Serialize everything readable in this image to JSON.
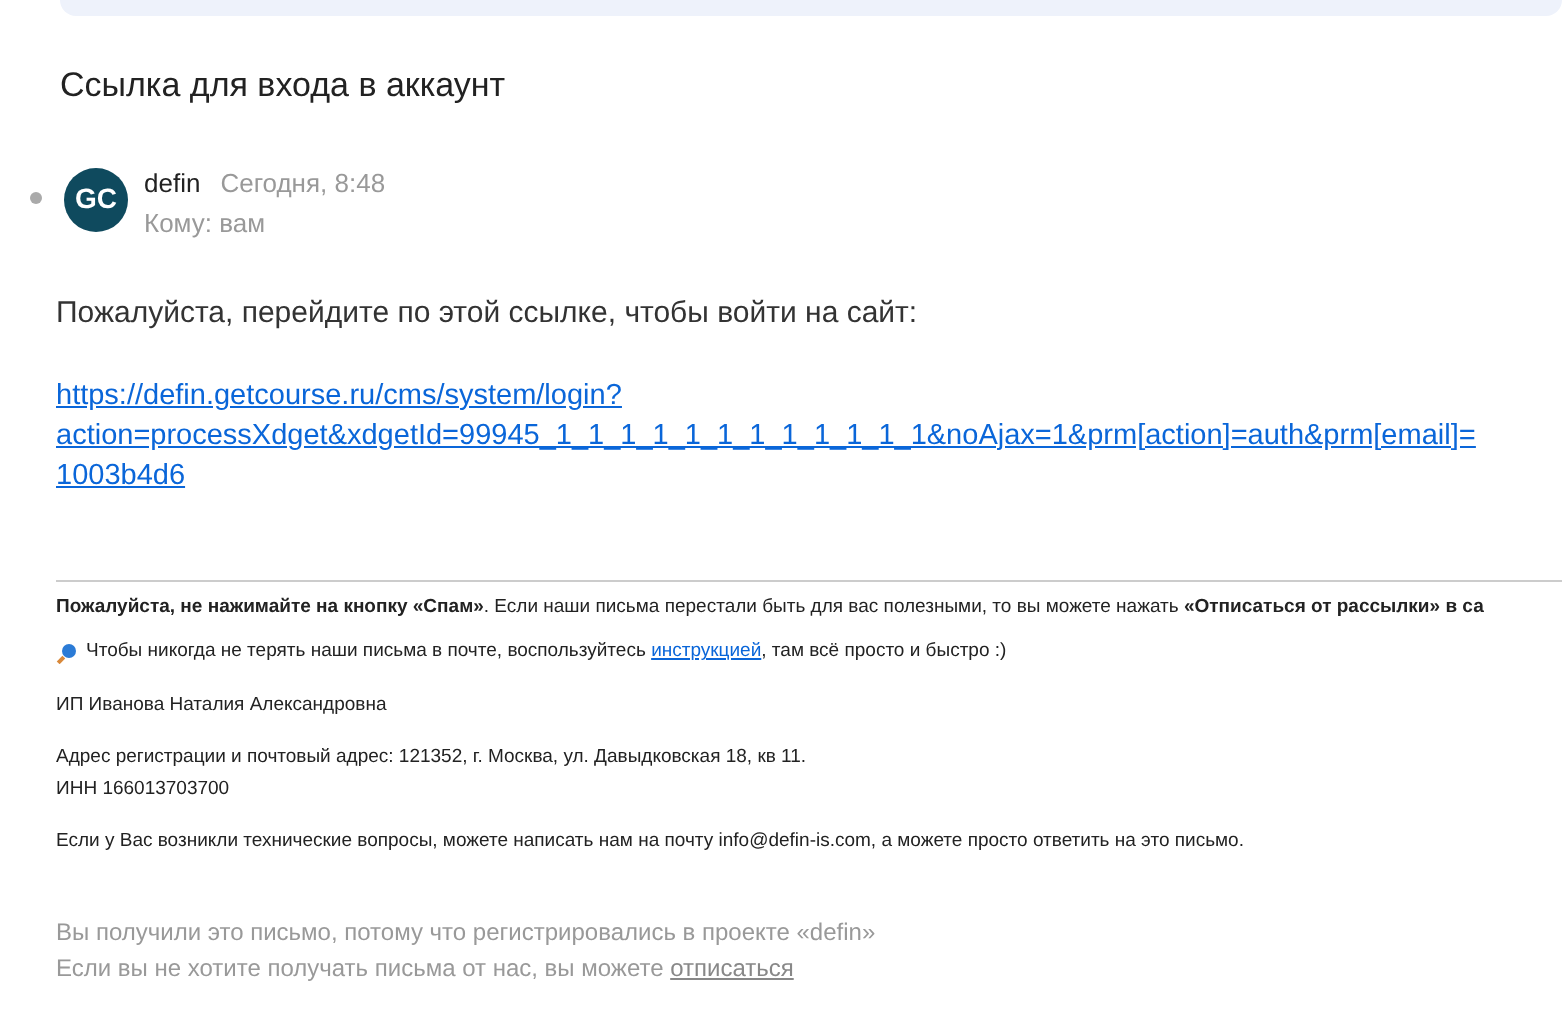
{
  "subject": "Ссылка для входа в аккаунт",
  "message": {
    "unread": true,
    "sender": "defin",
    "avatar_text": "GC",
    "time": "Сегодня, 8:48",
    "recipient": "Кому: вам"
  },
  "body": {
    "intro": "Пожалуйста, перейдите по этой ссылке, чтобы войти на сайт:",
    "link_lines": [
      "https://defin.getcourse.ru/cms/system/login?",
      "action=processXdget&xdgetId=99945_1_1_1_1_1_1_1_1_1_1_1_1&noAjax=1&prm[action]=auth&prm[email]=",
      "1003b4d6"
    ]
  },
  "footer": {
    "spam_note": "**Пожалуйста, не нажимайте на кнопку «Спам»**. Если наши письма перестали быть для вас полезными, то вы можете нажать **«Отписаться от рассылки» в са**",
    "tip_before": "Чтобы никогда не терять наши письма в почте, воспользуйтесь ",
    "tip_link": "инструкцией",
    "tip_after": ", там всё просто и быстро :)",
    "company": "ИП Иванова Наталия Александровна",
    "address": "Адрес регистрации и почтовый адрес: 121352, г. Москва, ул. Давыдковская 18, кв 11.",
    "inn": "ИНН 166013703700",
    "contact": "Если у Вас возникли технические вопросы, можете написать нам на почту info@defin-is.com, а можете просто ответить на это письмо."
  },
  "notice": {
    "reason": "Вы получили это письмо, потому что регистрировались в проекте «defin»",
    "unsubscribe_before": "Если вы не хотите получать письма от нас, вы можете ",
    "unsubscribe_link": "отписаться"
  }
}
